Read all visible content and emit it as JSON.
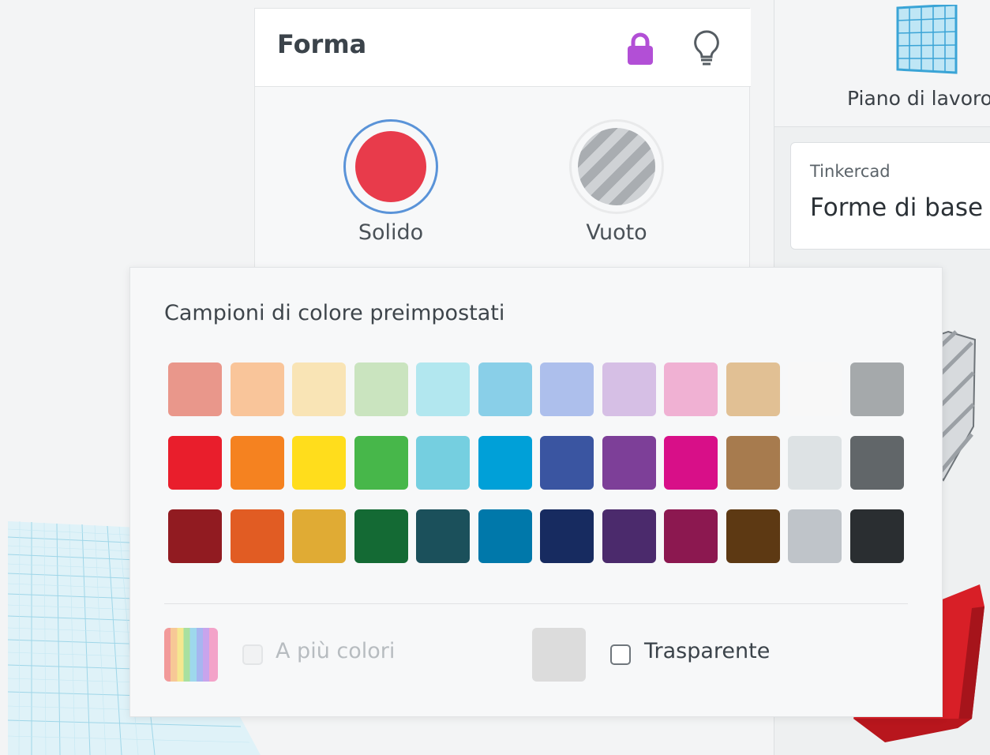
{
  "shape_panel": {
    "title": "Forma",
    "icons": {
      "lock": "lock-icon",
      "bulb": "lightbulb-icon"
    },
    "types": [
      {
        "label": "Solido",
        "color": "#e83b4b",
        "selected": true
      },
      {
        "label": "Vuoto",
        "color": "#b9bdc1",
        "selected": false
      }
    ]
  },
  "color_popover": {
    "title": "Campioni di colore preimpostati",
    "swatches": [
      [
        "#e9978b",
        "#f9c59a",
        "#f9e4b5",
        "#cae4bf",
        "#b2e7ef",
        "#89cfe8",
        "#adbfec",
        "#d6bfe5",
        "#f0b1d3",
        "#e1c094",
        "#f8f8f8",
        "#a5a9ab"
      ],
      [
        "#e91e2c",
        "#f58220",
        "#ffdd1c",
        "#47b74a",
        "#75cfe0",
        "#00a0d8",
        "#3a55a1",
        "#7d3f98",
        "#d80f88",
        "#a77b4e",
        "#dde2e4",
        "#616669"
      ],
      [
        "#911b21",
        "#e15c23",
        "#e0ab34",
        "#146a34",
        "#1b505b",
        "#0078aa",
        "#172b60",
        "#4b2a6c",
        "#8c1850",
        "#5d3913",
        "#bfc4c9",
        "#2a2e31"
      ]
    ],
    "multicolor": {
      "label": "A più colori",
      "checked": false,
      "enabled": false
    },
    "transparent": {
      "label": "Trasparente",
      "checked": false,
      "swatch_color": "#dcdcdc"
    }
  },
  "sidebar": {
    "workplane_label": "Piano di lavoro",
    "library": {
      "provider": "Tinkercad",
      "name": "Forme di base"
    }
  }
}
